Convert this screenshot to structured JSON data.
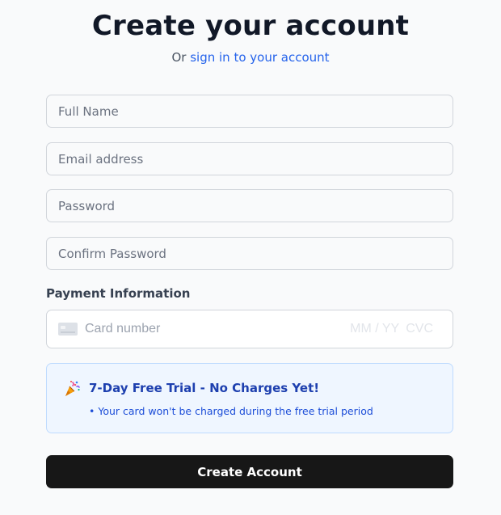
{
  "header": {
    "title": "Create your account",
    "subtitle_prefix": "Or",
    "signin_link": "sign in to your account"
  },
  "form": {
    "full_name": {
      "placeholder": "Full Name",
      "value": ""
    },
    "email": {
      "placeholder": "Email address",
      "value": ""
    },
    "password": {
      "placeholder": "Password",
      "value": ""
    },
    "confirm_password": {
      "placeholder": "Confirm Password",
      "value": ""
    }
  },
  "payment": {
    "label": "Payment Information",
    "card_icon": "credit-card-icon",
    "card_number_placeholder": "Card number",
    "expiry_placeholder": "MM / YY",
    "cvc_placeholder": "CVC"
  },
  "trial": {
    "icon": "party-popper-icon",
    "title": "7-Day Free Trial - No Charges Yet!",
    "note": "• Your card won't be charged during the free trial period"
  },
  "submit": {
    "label": "Create Account"
  },
  "colors": {
    "link": "#2563eb",
    "trial_bg": "#eff6ff",
    "trial_border": "#bfdbfe",
    "trial_text": "#1e40af",
    "button_bg": "#171717"
  }
}
